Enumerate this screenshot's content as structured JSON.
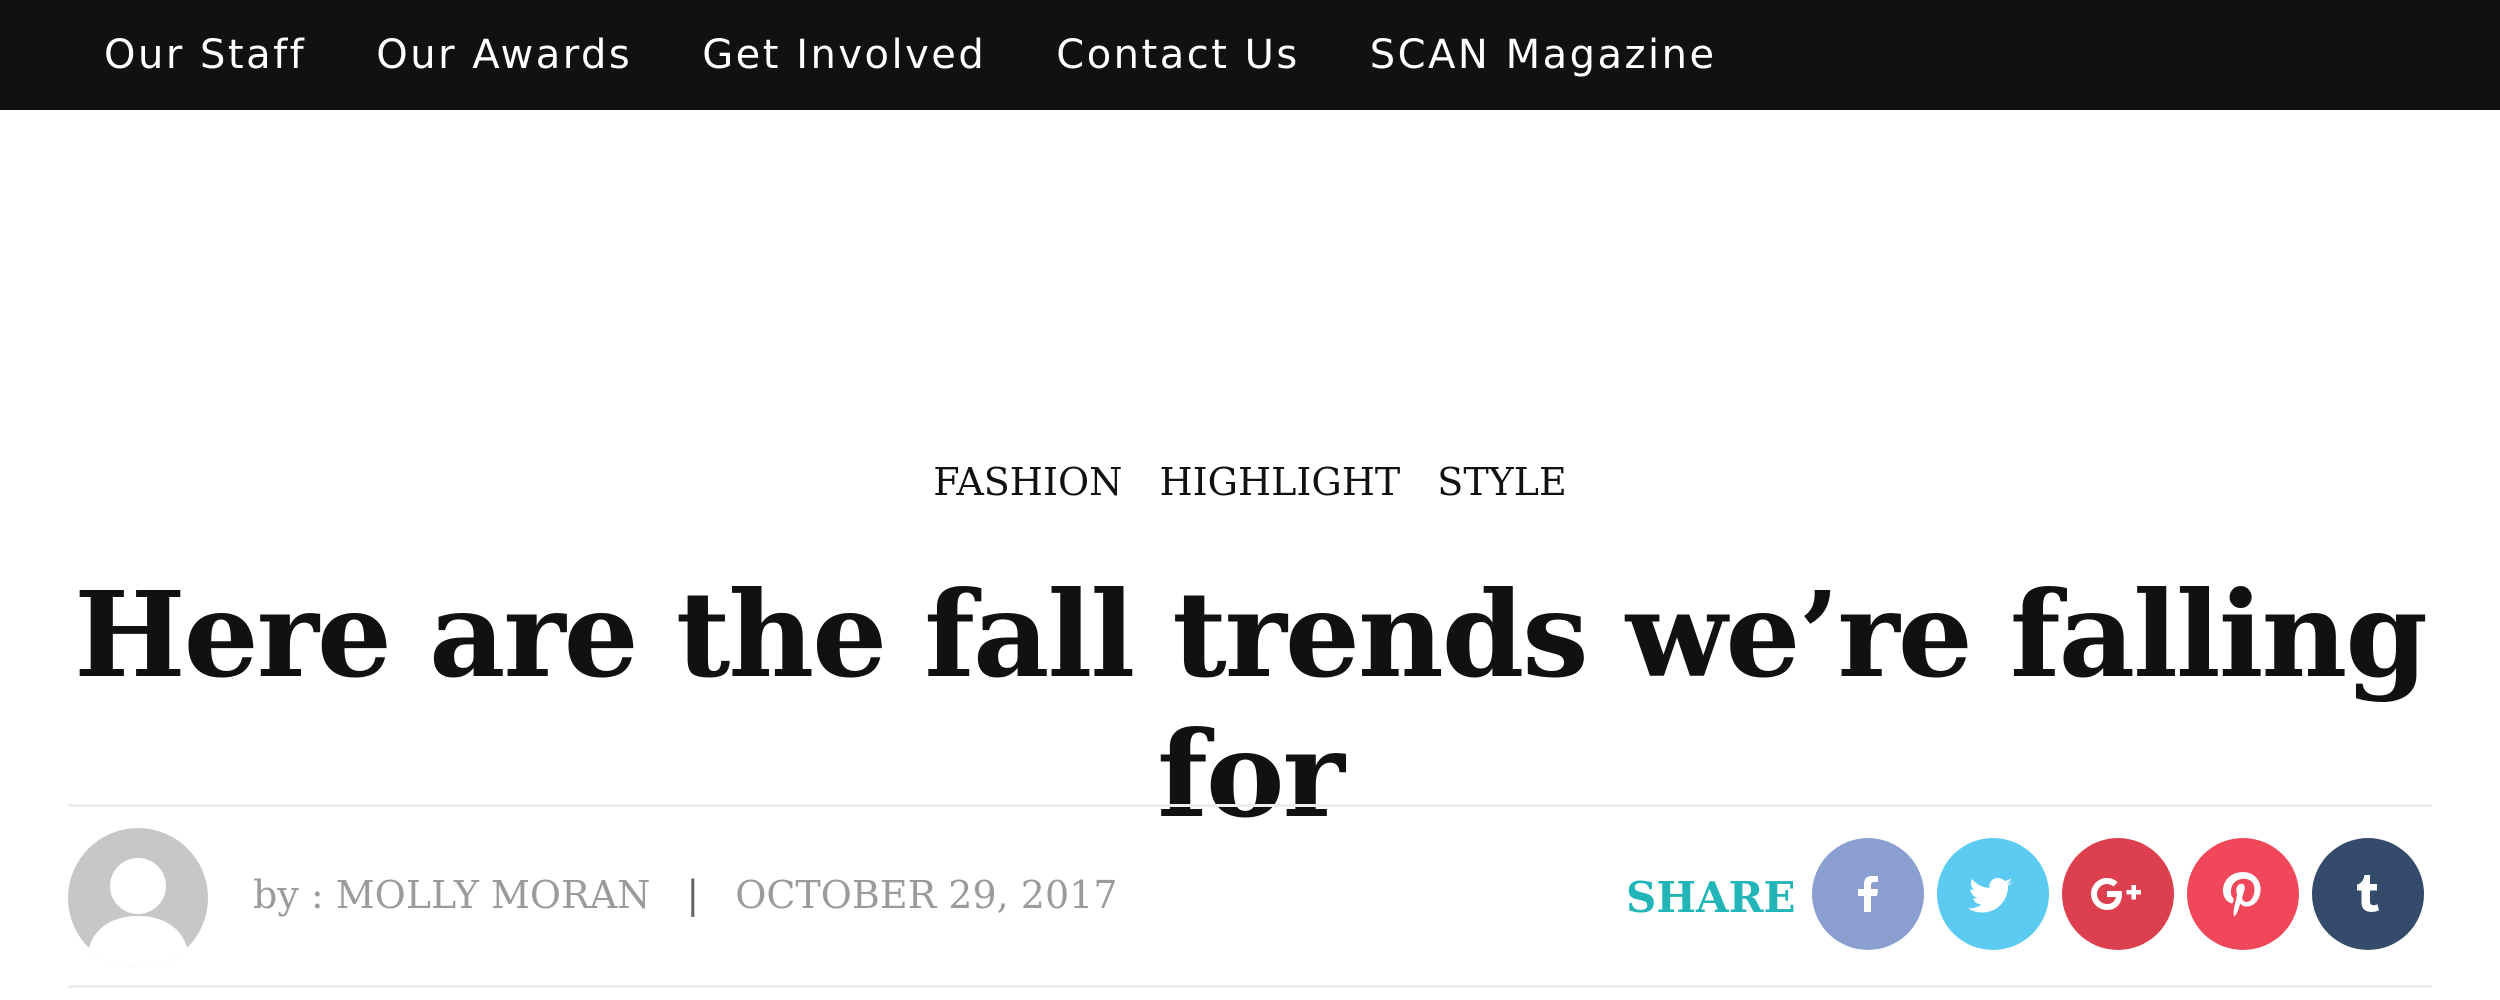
{
  "nav": {
    "items": [
      {
        "label": "Our Staff"
      },
      {
        "label": "Our Awards"
      },
      {
        "label": "Get Involved"
      },
      {
        "label": "Contact Us"
      },
      {
        "label": "SCAN Magazine"
      }
    ]
  },
  "article": {
    "categories": [
      "FASHION",
      "HIGHLIGHT",
      "STYLE"
    ],
    "title": "Here are the fall trends we’re falling for",
    "byline": "by : MOLLY MORAN",
    "separator": "|",
    "date": "OCTOBER 29, 2017"
  },
  "share": {
    "label": "SHARE",
    "buttons": [
      {
        "icon": "facebook-icon",
        "color": "#8a9fd0"
      },
      {
        "icon": "twitter-icon",
        "color": "#5bcbf2"
      },
      {
        "icon": "google-plus-icon",
        "color": "#dc3f4d"
      },
      {
        "icon": "pinterest-icon",
        "color": "#f0485a"
      },
      {
        "icon": "tumblr-icon",
        "color": "#344b6b"
      }
    ]
  },
  "colors": {
    "nav_bg": "#111111",
    "accent": "#21b5b8",
    "meta_text": "#9b9b9b",
    "avatar": "#c7c7c7"
  }
}
